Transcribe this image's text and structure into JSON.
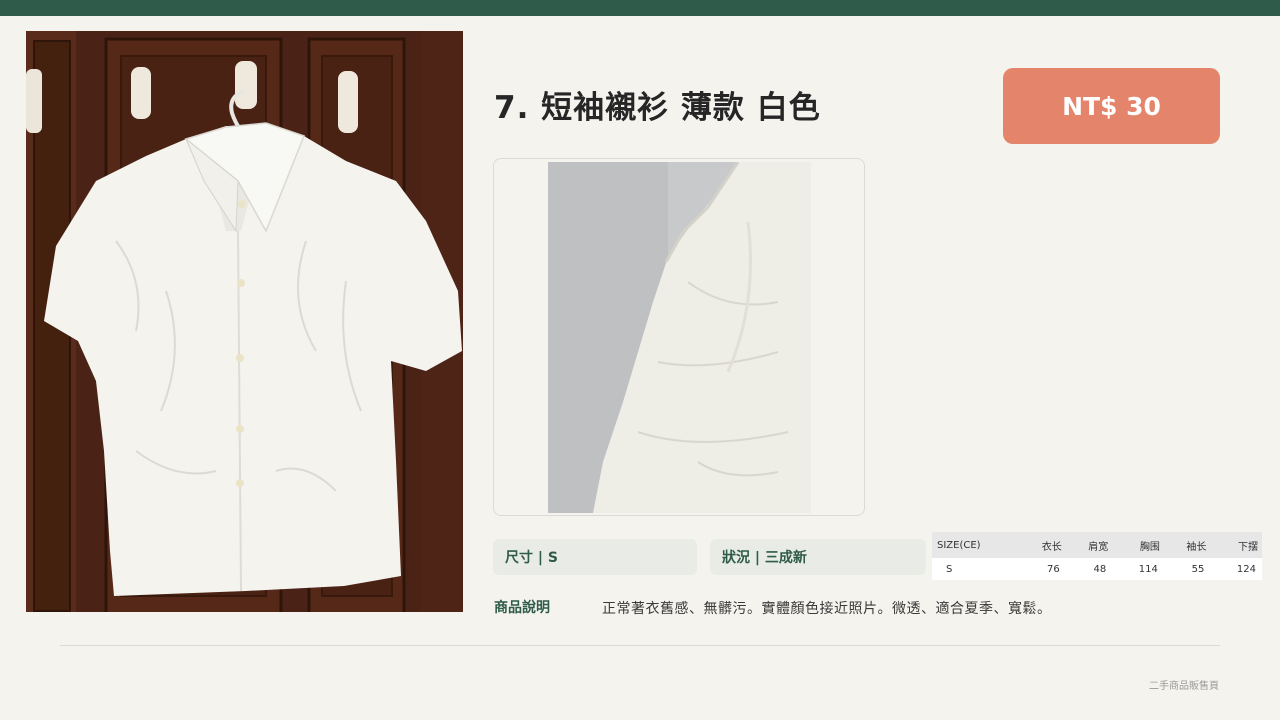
{
  "header": {
    "accent_color": "#2e5b4a"
  },
  "product": {
    "title": "7. 短袖襯衫 薄款 白色",
    "price": "NT$ 30",
    "price_color": "#e4856b",
    "main_image_alt": "白色短袖襯衫掛在木門上",
    "detail_image_alt": "襯衫布料特寫"
  },
  "attributes": {
    "size": "尺寸 | S",
    "condition": "狀況 | 三成新"
  },
  "size_table": {
    "headers": [
      "SIZE(CE)",
      "衣长",
      "肩宽",
      "胸围",
      "袖长",
      "下摆"
    ],
    "rows": [
      [
        "S",
        "76",
        "48",
        "114",
        "55",
        "124"
      ]
    ]
  },
  "description": {
    "label": "商品說明",
    "text": "正常著衣舊感、無髒污。實體顏色接近照片。微透、適合夏季、寬鬆。"
  },
  "footer": {
    "text": "二手商品販售頁"
  }
}
